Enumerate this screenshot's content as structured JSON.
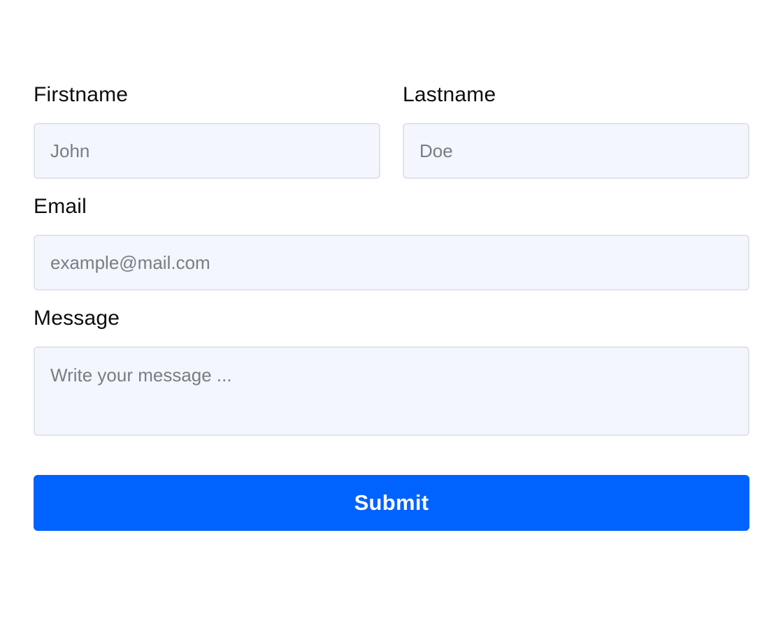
{
  "form": {
    "firstname": {
      "label": "Firstname",
      "placeholder": "John",
      "value": ""
    },
    "lastname": {
      "label": "Lastname",
      "placeholder": "Doe",
      "value": ""
    },
    "email": {
      "label": "Email",
      "placeholder": "example@mail.com",
      "value": ""
    },
    "message": {
      "label": "Message",
      "placeholder": "Write your message ...",
      "value": ""
    },
    "submit_label": "Submit",
    "colors": {
      "accent": "#0062ff",
      "input_bg": "#f3f6fc",
      "input_border": "#e0e4ea"
    }
  }
}
